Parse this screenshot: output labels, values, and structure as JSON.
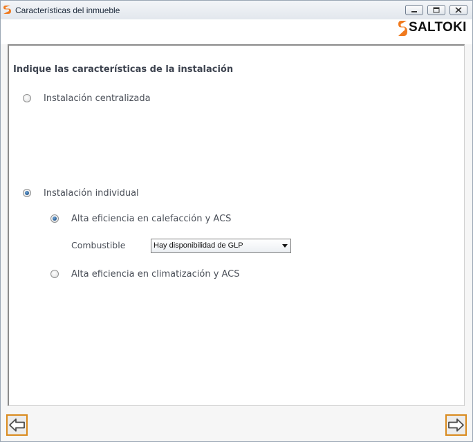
{
  "window": {
    "title": "Características del inmueble",
    "controls": {
      "minimize": "minimize-icon",
      "maximize": "maximize-icon",
      "close": "close-icon"
    }
  },
  "brand": {
    "name": "SALTOKI",
    "accent": "#f07a1e"
  },
  "form": {
    "heading": "Indique las características de la instalación",
    "options": [
      {
        "label": "Instalación centralizada",
        "selected": false
      },
      {
        "label": "Instalación individual",
        "selected": true
      }
    ],
    "sub_options": [
      {
        "label": "Alta eficiencia en calefacción y ACS",
        "selected": true
      },
      {
        "label": "Alta eficiencia en climatización y ACS",
        "selected": false
      }
    ],
    "combustible": {
      "label": "Combustible",
      "value": "Hay disponibilidad de GLP"
    }
  },
  "nav": {
    "back_icon": "arrow-left-icon",
    "next_icon": "arrow-right-icon",
    "border_color": "#d98a1d"
  }
}
